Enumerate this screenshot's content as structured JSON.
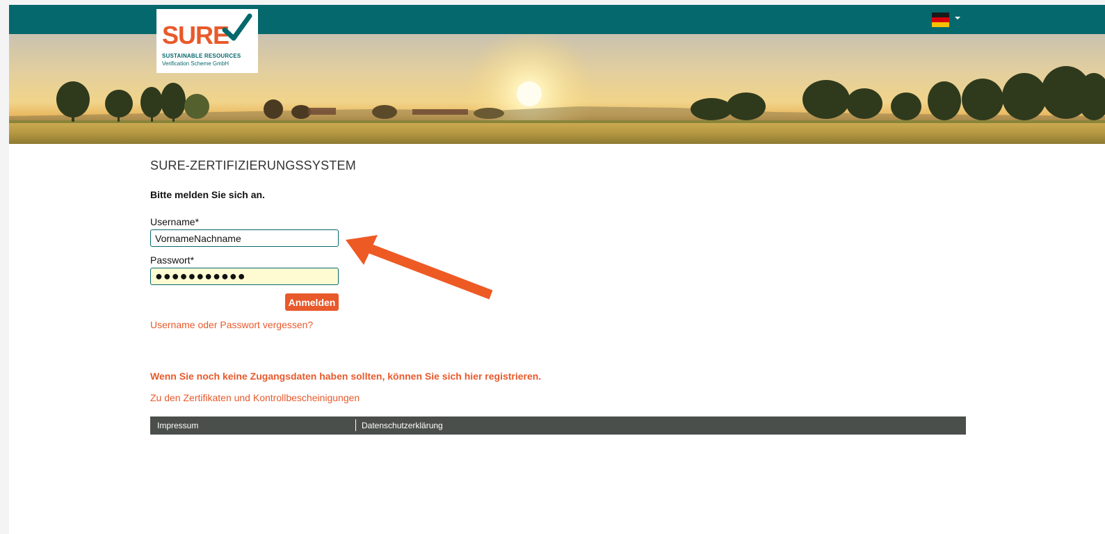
{
  "header": {
    "logo": {
      "word": "SURE",
      "line1": "SUSTAINABLE RESOURCES",
      "line2": "Verification Scheme GmbH"
    },
    "language": {
      "icon": "german-flag-icon",
      "current": "de"
    }
  },
  "main": {
    "title": "SURE-ZERTIFIZIERUNGSSYSTEM",
    "prompt": "Bitte melden Sie sich an.",
    "username_label": "Username*",
    "username_value": "VornameNachname",
    "password_label": "Passwort*",
    "password_value": "●●●●●●●●●●●",
    "login_button": "Anmelden",
    "forgot_link": "Username oder Passwort vergessen?",
    "register_link": "Wenn Sie noch keine Zugangsdaten haben sollten, können Sie sich hier registrieren.",
    "certificates_link": "Zu den Zertifikaten und Kontrollbescheinigungen"
  },
  "footer": {
    "impressum": "Impressum",
    "privacy": "Datenschutzerklärung"
  },
  "colors": {
    "accent": "#e8592b",
    "brand_teal": "#05686c",
    "footer_bg": "#4b4f4c",
    "password_bg": "#fefbd3"
  }
}
